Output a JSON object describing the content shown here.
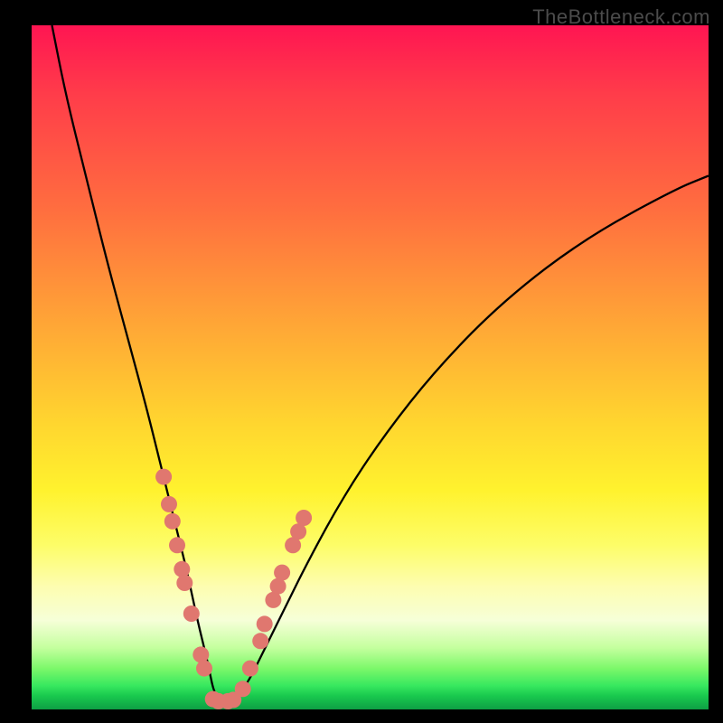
{
  "watermark": "TheBottleneck.com",
  "colors": {
    "dot": "#e0776f",
    "curve": "#000000",
    "gradient_stops": [
      "#ff1552",
      "#ff3c4a",
      "#ff6e3f",
      "#ffa736",
      "#ffd52f",
      "#fff22e",
      "#fdfd68",
      "#fdfdb0",
      "#f6ffd8",
      "#c4ff9e",
      "#7cf86a",
      "#38e85f",
      "#19c94e",
      "#0e9f44"
    ]
  },
  "chart_data": {
    "type": "line",
    "title": "",
    "xlabel": "",
    "ylabel": "",
    "xlim": [
      0,
      100
    ],
    "ylim": [
      0,
      100
    ],
    "grid": false,
    "legend": false,
    "description": "Bottleneck curve: V-shaped profile. Left branch descends steeply from top-left, right branch rises more gently toward upper-right. Minimum (≈0) near x≈27. Background vertical gradient encodes severity (red high → green low).",
    "series": [
      {
        "name": "bottleneck-curve",
        "x": [
          3,
          5,
          8,
          11,
          14,
          17,
          19,
          21,
          23,
          24.5,
          26,
          27,
          28.5,
          30,
          32,
          34,
          37,
          41,
          46,
          52,
          60,
          70,
          82,
          95,
          100
        ],
        "y": [
          100,
          90,
          78,
          66,
          55,
          44,
          36,
          28,
          20,
          13,
          7,
          2,
          1,
          1.5,
          4,
          8,
          14,
          22,
          31,
          40,
          50,
          60,
          69,
          76,
          78
        ]
      }
    ],
    "highlight_points": {
      "name": "sample-dots",
      "comment": "Salmon circles clustered on both branches near the bottom of the V and along the floor.",
      "points": [
        {
          "x": 19.5,
          "y": 34
        },
        {
          "x": 20.3,
          "y": 30
        },
        {
          "x": 20.8,
          "y": 27.5
        },
        {
          "x": 21.5,
          "y": 24
        },
        {
          "x": 22.2,
          "y": 20.5
        },
        {
          "x": 22.6,
          "y": 18.5
        },
        {
          "x": 23.6,
          "y": 14
        },
        {
          "x": 25.0,
          "y": 8
        },
        {
          "x": 25.5,
          "y": 6
        },
        {
          "x": 26.8,
          "y": 1.5
        },
        {
          "x": 27.6,
          "y": 1.2
        },
        {
          "x": 29.0,
          "y": 1.2
        },
        {
          "x": 29.8,
          "y": 1.4
        },
        {
          "x": 31.2,
          "y": 3
        },
        {
          "x": 32.3,
          "y": 6
        },
        {
          "x": 33.8,
          "y": 10
        },
        {
          "x": 34.4,
          "y": 12.5
        },
        {
          "x": 35.7,
          "y": 16
        },
        {
          "x": 36.4,
          "y": 18
        },
        {
          "x": 37.0,
          "y": 20
        },
        {
          "x": 38.6,
          "y": 24
        },
        {
          "x": 39.4,
          "y": 26
        },
        {
          "x": 40.2,
          "y": 28
        }
      ]
    }
  }
}
